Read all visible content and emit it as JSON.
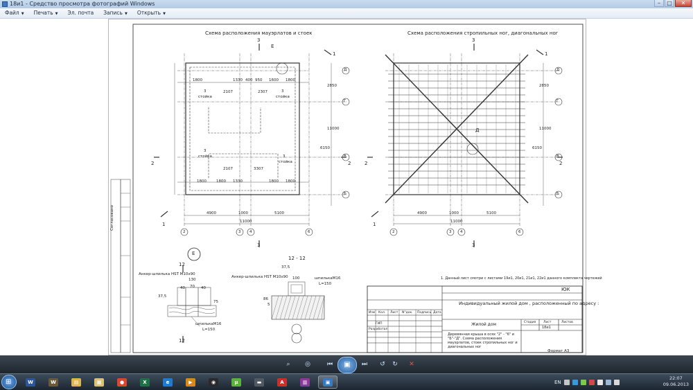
{
  "window": {
    "title": "18и1 - Средство просмотра фотографий Windows",
    "minimize": "–",
    "maximize": "□",
    "close": "✕"
  },
  "menu": {
    "items": [
      {
        "label": "Файл",
        "caret": "▼"
      },
      {
        "label": "Печать",
        "caret": "▼"
      },
      {
        "label": "Эл. почта",
        "caret": ""
      },
      {
        "label": "Запись",
        "caret": "▼"
      },
      {
        "label": "Открыть",
        "caret": "▼"
      }
    ]
  },
  "drawing": {
    "plan_left_title": "Схема расположения мауэрлатов и стоек",
    "plan_right_title": "Схема расположения стропильных ног, диагональных ног",
    "axis_letters": [
      "Д",
      "Г",
      "В",
      "Б"
    ],
    "axis_numbers": [
      "2",
      "3",
      "4",
      "6"
    ],
    "section_marks": [
      "1",
      "2",
      "3"
    ],
    "dims_left": [
      "1800",
      "1330",
      "400",
      "950",
      "1600",
      "1800",
      "2107",
      "2307",
      "3307"
    ],
    "dims_bottom": [
      "4900",
      "1000",
      "5100",
      "11000"
    ],
    "dims_vertical": [
      "2850",
      "11000",
      "6150"
    ],
    "post_label": "стойка",
    "callout_e": "Е",
    "callout_d": "Д",
    "detail_left_title": "12",
    "detail_left_bolt": "Анкер-шпилька HST M10x90",
    "detail_left_stud": "шпилькаM16",
    "detail_left_len": "L=150",
    "detail_left_dims": [
      "130",
      "70",
      "40",
      "40",
      "37,5",
      "75"
    ],
    "detail_right_title": "12 - 12",
    "detail_right_bolt": "Анкер-шпилька HST M10x90",
    "detail_right_stud": "шпилькаM16",
    "detail_right_len": "L=150",
    "detail_right_dims": [
      "37,5",
      "100",
      "86",
      "5"
    ],
    "side_label": "Согласовано",
    "note": "1. Данный лист смотри с листами 19и1, 20и1, 21и1, 22и1 данного комплекта чертежей",
    "stamp_code": "ЮК",
    "stamp_project": "Индивидуальный жилой дом , расположенный по адресу :",
    "stamp_building": "Жилой дом",
    "stamp_sheet_title": "Деревянная крыша  в осях  \"2\" - \"6\" и \"Б\"-\"Д\". Схема расположения мауэрлатов, стоек стропильных ног и диагональных ног",
    "stamp_headers": [
      "Изм",
      "Кол.",
      "Лист",
      "N°док.",
      "Подпись",
      "Дата"
    ],
    "stamp_roles": [
      "ГИП",
      "Разработал"
    ],
    "stamp_stage": "Стадия",
    "stamp_sheet": "Лист",
    "stamp_sheets": "Листов",
    "stamp_sheet_no": "18и1",
    "format": "Формат А3"
  },
  "viewer_controls": {
    "zoom": "⌕",
    "actual_size": "◎",
    "prev": "⏮",
    "slideshow": "▣",
    "next": "⏭",
    "rotate_left": "↺",
    "rotate_right": "↻",
    "delete": "✕"
  },
  "taskbar": {
    "start_glyph": "⊞",
    "apps": [
      {
        "name": "word",
        "glyph": "W",
        "color": "#2b5797"
      },
      {
        "name": "world-of-tanks",
        "glyph": "W",
        "color": "#6b5a3a"
      },
      {
        "name": "folder",
        "glyph": "▤",
        "color": "#e0b64a"
      },
      {
        "name": "explorer",
        "glyph": "▦",
        "color": "#d8c27a"
      },
      {
        "name": "chrome",
        "glyph": "●",
        "color": "#e0442f"
      },
      {
        "name": "excel",
        "glyph": "X",
        "color": "#1e7145"
      },
      {
        "name": "internet-explorer",
        "glyph": "e",
        "color": "#1f7bd1"
      },
      {
        "name": "media",
        "glyph": "▶",
        "color": "#d68a1e"
      },
      {
        "name": "player",
        "glyph": "◉",
        "color": "#2a2a2a"
      },
      {
        "name": "utorrent",
        "glyph": "µ",
        "color": "#5bb23a"
      },
      {
        "name": "tank",
        "glyph": "▬",
        "color": "#505a64"
      },
      {
        "name": "pdf",
        "glyph": "A",
        "color": "#c8312a"
      },
      {
        "name": "archive",
        "glyph": "▥",
        "color": "#8a3a9a"
      },
      {
        "name": "photo-viewer",
        "glyph": "▣",
        "color": "#3a7ab8"
      }
    ],
    "lang": "EN",
    "time": "22:07",
    "date": "09.06.2013"
  }
}
